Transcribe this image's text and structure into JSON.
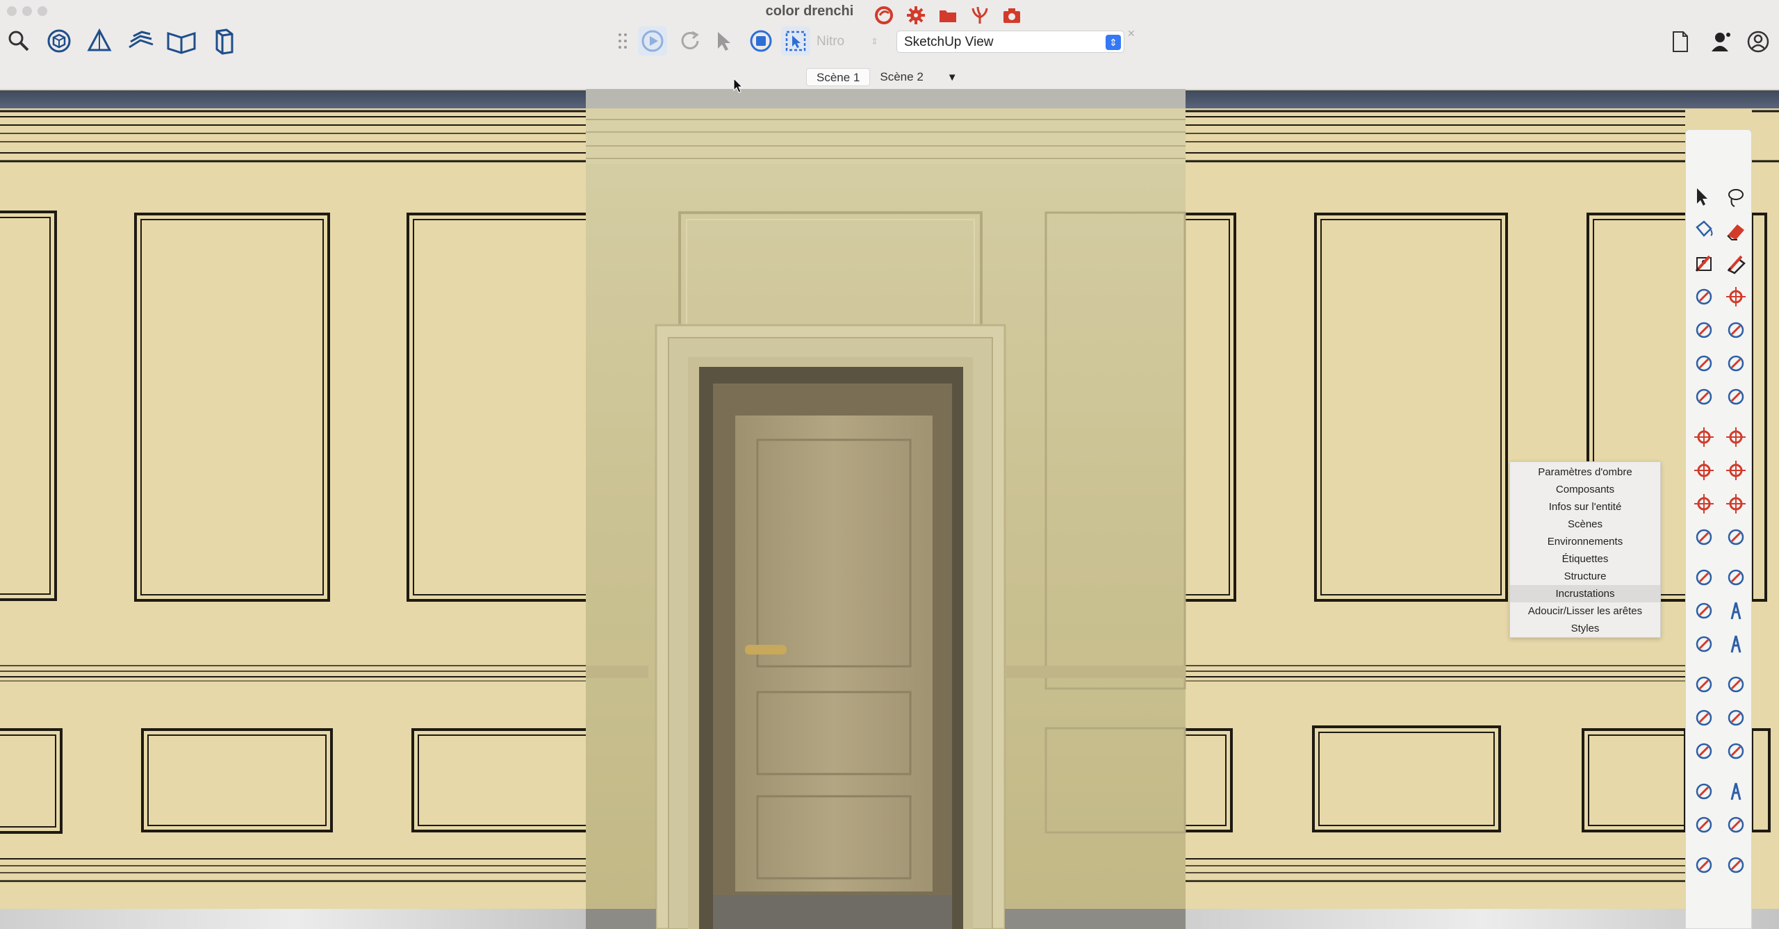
{
  "window": {
    "title": "color drenchi"
  },
  "left_toolbar": {
    "icons": [
      "search-icon",
      "component-icon",
      "section-plane-icon",
      "sandbox-icon",
      "open-book-icon",
      "box-icon"
    ]
  },
  "red_toolbar": {
    "icons": [
      "swirl-logo-icon",
      "gear-icon",
      "folder-icon",
      "plant-icon",
      "camera-icon"
    ]
  },
  "render_toolbar": {
    "icons": [
      "grip-icon",
      "play-icon",
      "refresh-icon",
      "cursor-icon",
      "stop-icon",
      "select-box-icon"
    ],
    "engine_select": "Nitro",
    "view_select": "SketchUp View"
  },
  "right_toolbar": {
    "icons": [
      "document-icon",
      "user-icon",
      "account-icon"
    ]
  },
  "scenes": {
    "tabs": [
      "Scène 1",
      "Scène 2"
    ],
    "active": 0,
    "menu_glyph": "▼"
  },
  "context_menu": {
    "items": [
      "Paramètres d'ombre",
      "Composants",
      "Infos sur l'entité",
      "Scènes",
      "Environnements",
      "Étiquettes",
      "Structure",
      "Incrustations",
      "Adoucir/Lisser les arêtes",
      "Styles"
    ],
    "highlighted": "Incrustations"
  },
  "tool_palette": {
    "tools": [
      "select-icon",
      "lasso-icon",
      "paint-bucket-icon",
      "eraser-icon",
      "tag-icon",
      "smooth-eraser-icon",
      "pencil-icon",
      "freehand-icon",
      "rectangle-icon",
      "rotated-rectangle-icon",
      "circle-icon",
      "polygon-icon",
      "arc-icon",
      "two-point-arc-icon",
      "three-point-arc-icon",
      "pie-icon",
      "move-icon",
      "push-pull-icon",
      "rotate-icon",
      "follow-me-icon",
      "scale-icon",
      "offset-icon",
      "flip-icon",
      "solid-tools-icon",
      "tape-measure-icon",
      "dimension-icon",
      "protractor-icon",
      "text-icon",
      "axes-icon",
      "3d-text-icon",
      "orbit-icon",
      "pan-icon",
      "zoom-icon",
      "zoom-window-icon",
      "zoom-extents-icon",
      "previous-view-icon",
      "position-camera-icon",
      "walk-icon",
      "look-around-icon",
      "section-icon",
      "advanced-camera-icon",
      "sandbox-tools-icon"
    ]
  },
  "colors": {
    "wall": "#e6d8a8",
    "render_wall": "#cbbf8e",
    "door": "#b4a67e",
    "molding_line": "#1e1a12",
    "accent_red": "#d23b2b",
    "accent_blue": "#3478f6",
    "top_band": "#4a5466"
  }
}
